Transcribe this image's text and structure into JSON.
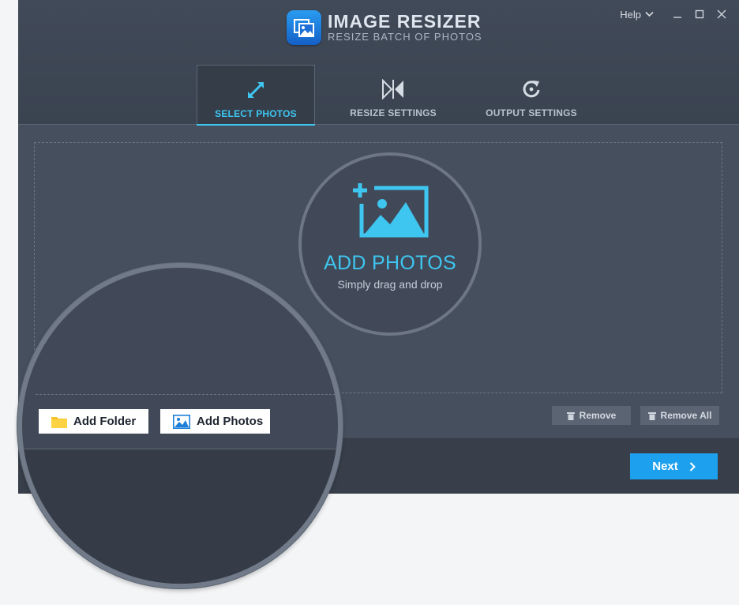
{
  "app": {
    "title": "IMAGE RESIZER",
    "subtitle": "RESIZE BATCH OF PHOTOS",
    "brand_color": "#1da1ef",
    "accent_color": "#3ec6f0"
  },
  "window_controls": {
    "help_label": "Help",
    "icons": [
      "chevron-down-icon",
      "minimize-icon",
      "maximize-icon",
      "close-icon"
    ]
  },
  "tabs": [
    {
      "label": "SELECT PHOTOS",
      "icon": "expand-arrows-icon",
      "active": true
    },
    {
      "label": "RESIZE SETTINGS",
      "icon": "resize-arrows-icon",
      "active": false
    },
    {
      "label": "OUTPUT SETTINGS",
      "icon": "refresh-icon",
      "active": false
    }
  ],
  "dropzone": {
    "title": "ADD PHOTOS",
    "subtitle": "Simply drag and drop",
    "icon": "add-photo-icon"
  },
  "list_actions": {
    "remove_label": "Remove",
    "remove_all_label": "Remove All",
    "icon": "trash-icon"
  },
  "magnified": {
    "add_folder_label": "Add Folder",
    "add_photos_label": "Add Photos",
    "icons": [
      "folder-icon",
      "image-icon"
    ]
  },
  "footer": {
    "next_label": "Next",
    "icon": "chevron-right-icon"
  }
}
